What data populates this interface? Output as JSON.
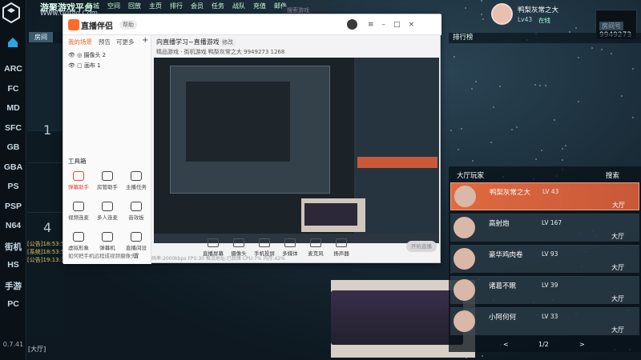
{
  "site": {
    "title": "游聚游戏平台",
    "url": "Www.Gqtvg.Com"
  },
  "topnav": [
    "商城",
    "空间",
    "回放",
    "主页",
    "排行",
    "会员",
    "任务",
    "战队",
    "充值",
    "邮件"
  ],
  "top_search_placeholder": "搜索游戏",
  "sidebar": {
    "items": [
      "ARC",
      "FC",
      "MD",
      "SFC",
      "GB",
      "GBA",
      "PS",
      "PSP",
      "N64",
      "街机",
      "HS",
      "手游",
      "PC"
    ],
    "version": "0.7.41"
  },
  "gamelist": {
    "tab": "房间",
    "numbers": [
      "1",
      "4"
    ],
    "chat": [
      "[公告]18:53:5",
      "[系统]18:53:5",
      "[公告]19:13:1"
    ],
    "footer": "[大厅]"
  },
  "app": {
    "name": "直播伴侣",
    "tag": "帮助",
    "tabs": [
      "我的场景",
      "预告",
      "可更多"
    ],
    "scenes": [
      "摄像头 2",
      "画布 1"
    ],
    "tools_label": "工具箱",
    "tools": [
      "弹幕助手",
      "房管助手",
      "主播任务",
      "视频连麦",
      "多人连麦",
      "音效板",
      "虚拟形象",
      "弹幕机",
      "直播间设置"
    ],
    "help": "如何把手机远程成视频摄像头?",
    "stream_title": "向直播学习~直播游戏之子!",
    "stream_chip": "修改",
    "stream_info": "精品游戏 · 街机游戏   鸭梨灰常之大   9949273   1268",
    "controls": [
      "直播屏幕",
      "摄像头",
      "手机投屏",
      "多媒体",
      "麦克风",
      "扬声器"
    ],
    "live_button": "开始直播",
    "status": "码率:2000kbps  FPS:30  推流地址:已就绪  CPU:7%  内存:42%"
  },
  "right": {
    "profile": {
      "name": "鸭梨灰常之大",
      "level": "Lv43",
      "status": "在线"
    },
    "room": {
      "label": "房间号",
      "number": "9949273"
    },
    "rank_title": "排行榜",
    "hall": {
      "title": "大厅玩家",
      "search": "搜索",
      "room_word": "大厅",
      "pager": "1/2"
    },
    "players": [
      {
        "name": "鸭梨灰常之大",
        "level": "LV 43",
        "me": true
      },
      {
        "name": "高射炮",
        "level": "LV 167",
        "me": false
      },
      {
        "name": "豪华鸡肉卷",
        "level": "LV 93",
        "me": false
      },
      {
        "name": "诸葛不眠",
        "level": "LV 39",
        "me": false
      },
      {
        "name": "小阿何何",
        "level": "LV 33",
        "me": false
      }
    ]
  }
}
